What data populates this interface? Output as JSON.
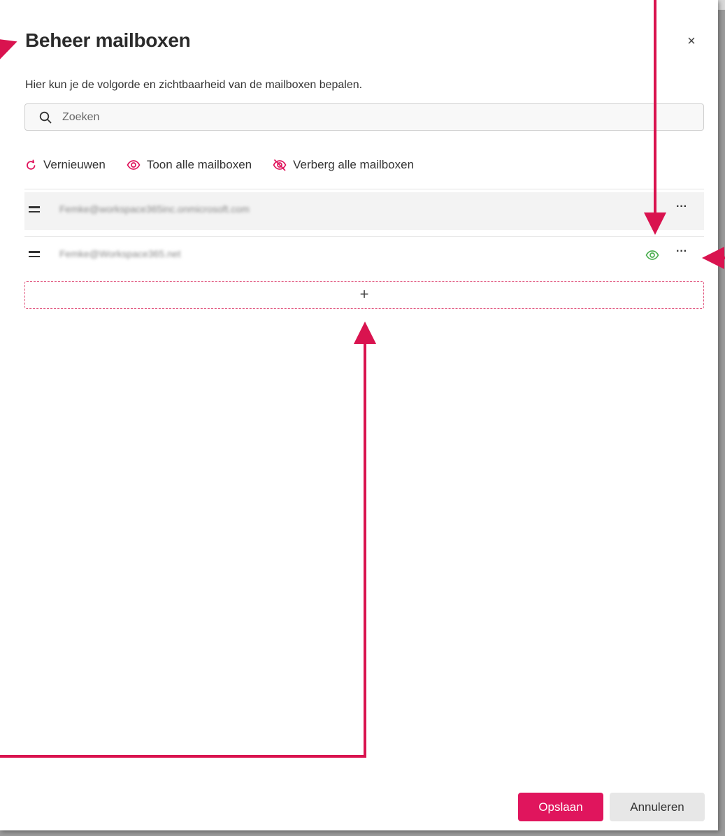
{
  "dialog": {
    "title": "Beheer mailboxen",
    "description": "Hier kun je de volgorde en zichtbaarheid van de mailboxen bepalen."
  },
  "search": {
    "placeholder": "Zoeken",
    "value": ""
  },
  "actions": {
    "refresh": "Vernieuwen",
    "show_all": "Toon alle mailboxen",
    "hide_all": "Verberg alle mailboxen"
  },
  "mailboxes": [
    {
      "email": "Femke@workspace365inc.onmicrosoft.com"
    },
    {
      "email": "Femke@Workspace365.net",
      "visible_icon": "eye-icon"
    }
  ],
  "add_label": "+",
  "footer": {
    "save": "Opslaan",
    "cancel": "Annuleren"
  },
  "more_label": "···",
  "close_label": "×",
  "colors": {
    "accent": "#e0155d",
    "visible": "#4caf50",
    "annotation": "#d9134f"
  }
}
